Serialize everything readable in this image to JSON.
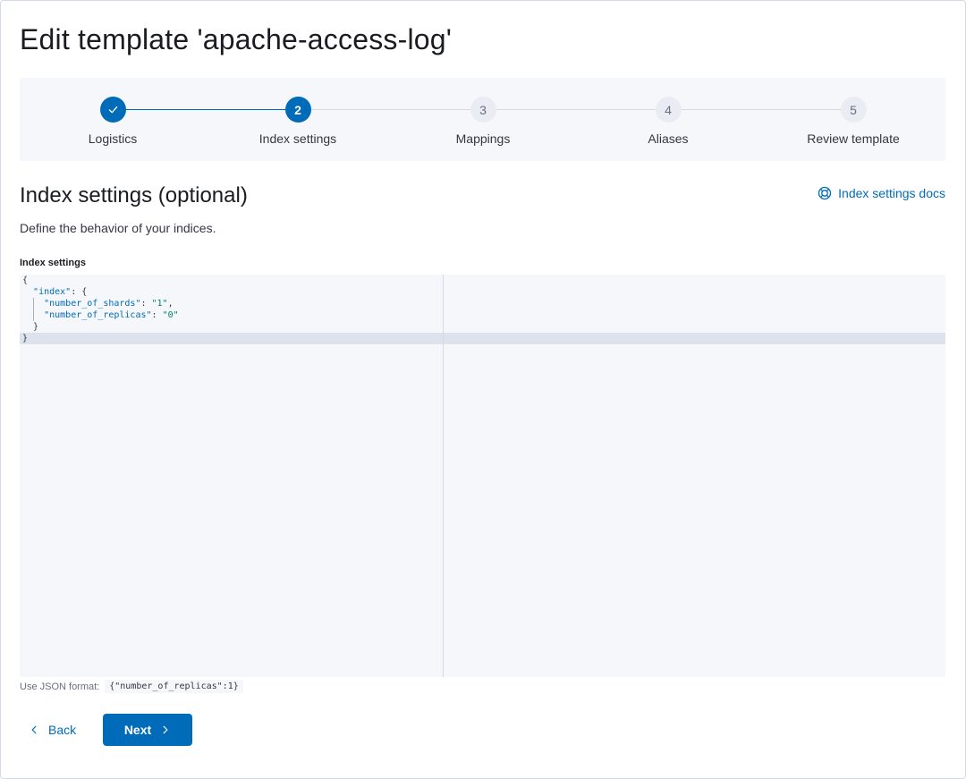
{
  "page": {
    "title": "Edit template 'apache-access-log'"
  },
  "steps": [
    {
      "number": "",
      "label": "Logistics",
      "status": "complete",
      "icon": "check-icon"
    },
    {
      "number": "2",
      "label": "Index settings",
      "status": "current"
    },
    {
      "number": "3",
      "label": "Mappings",
      "status": "incomplete"
    },
    {
      "number": "4",
      "label": "Aliases",
      "status": "incomplete"
    },
    {
      "number": "5",
      "label": "Review template",
      "status": "incomplete"
    }
  ],
  "section": {
    "title": "Index settings (optional)",
    "description": "Define the behavior of your indices.",
    "docs_link": "Index settings docs",
    "docs_icon": "lifebuoy-icon"
  },
  "editor": {
    "label": "Index settings",
    "lines": [
      "{",
      "  \"index\": {",
      "    \"number_of_shards\": \"1\",",
      "    \"number_of_replicas\": \"0\"",
      "  }",
      "}"
    ]
  },
  "help": {
    "prefix": "Use JSON format:",
    "example": "{\"number_of_replicas\":1}"
  },
  "actions": {
    "back_label": "Back",
    "next_label": "Next"
  },
  "colors": {
    "primary": "#006bb8",
    "background_panel": "#f5f7fa",
    "incomplete_step": "#e9edf3",
    "text": "#343741"
  }
}
